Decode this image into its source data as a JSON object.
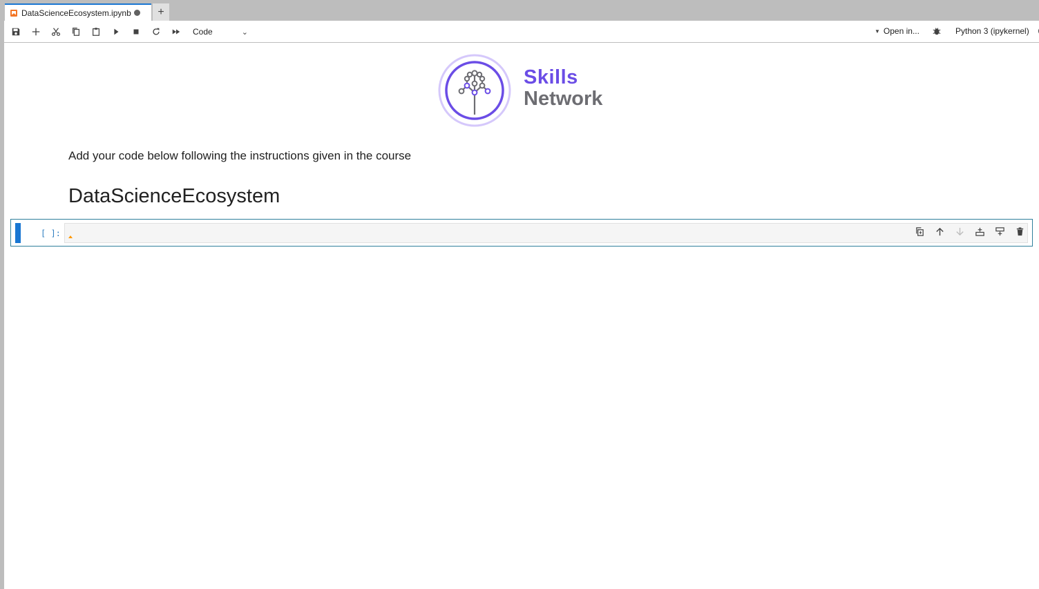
{
  "tab": {
    "title": "DataScienceEcosystem.ipynb",
    "new_tab_label": "+"
  },
  "toolbar": {
    "buttons": [
      "save-icon",
      "add-cell-icon",
      "cut-icon",
      "copy-icon",
      "paste-icon",
      "run-icon",
      "stop-icon",
      "restart-icon",
      "fast-forward-icon"
    ],
    "cell_type": "Code",
    "open_in": "Open in...",
    "kernel": "Python 3 (ipykernel)"
  },
  "logo": {
    "line1": "Skills",
    "line2": "Network",
    "accent": "#6b4de6"
  },
  "markdown": {
    "paragraph": "Add your code below following the instructions given in the course",
    "heading": "DataScienceEcosystem"
  },
  "code_cell": {
    "prompt": "[ ]:",
    "tools": [
      "duplicate-icon",
      "move-up-icon",
      "move-down-icon",
      "insert-above-icon",
      "insert-below-icon",
      "delete-icon"
    ]
  }
}
